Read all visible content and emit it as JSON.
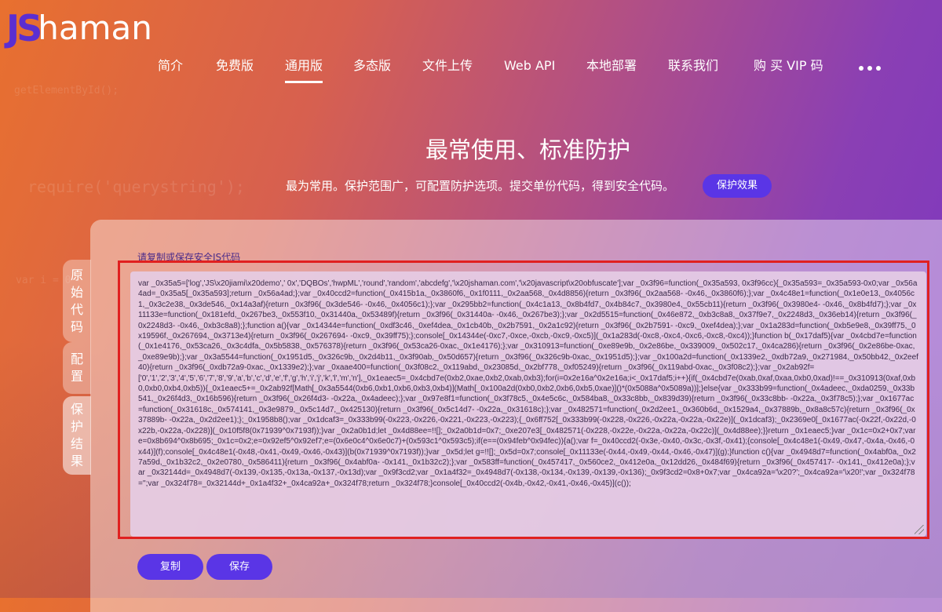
{
  "logo": {
    "js": "JS",
    "rest": "haman"
  },
  "nav": {
    "items": [
      "简介",
      "免费版",
      "通用版",
      "多态版",
      "文件上传",
      "Web API",
      "本地部署",
      "联系我们",
      "购 买 VIP 码"
    ],
    "active_index": 2
  },
  "background_code": [
    "getElementById();",
    "require('querystring');",
    "var i = 0"
  ],
  "hero": {
    "title": "最常使用、标准防护",
    "subtitle": "最为常用。保护范围广，可配置防护选项。提交单份代码，得到安全代码。",
    "button": "保护效果"
  },
  "side_tabs": [
    "原始代码",
    "配置",
    "保护结果"
  ],
  "result": {
    "label": "请复制或保存安全JS代码",
    "code": "var _0x35a5=['log','JS\\x20jiami\\x20demo',' 0x','DQBOs','hwpML','round','random','abcdefg','\\x20jshaman.com','\\x20javascript\\x20obfuscate'];var _0x3f96=function(_0x35a593, 0x3f96cc){_0x35a593=_0x35a593-0x0;var _0x56a4ad=_0x35a5[_0x35a593];return _0x56a4ad;};var _0x40ccd2=function(_0x415b1a,_0x3860f6,_0x1f0111,_0x2aa568,_0x4d8856){return _0x3f96(_0x2aa568- -0x46,_0x3860f6);};var _0x4c48e1=function(_0x1e0e13,_0x4056c1,_0x3c2e38,_0x3de546,_0x14a3af){return _0x3f96(_0x3de546- -0x46,_0x4056c1);};var _0x295bb2=function(_0x4c1a13,_0x8b4fd7,_0x4b84c7,_0x3980e4,_0x55cb11){return _0x3f96(_0x3980e4- -0x46,_0x8b4fd7);};var _0x11133e=function(_0x181efd,_0x267be3,_0x553f10,_0x31440a,_0x53489f){return _0x3f96(_0x31440a- -0x46,_0x267be3);};var _0x2d5515=function(_0x46e872,_0xb3c8a8,_0x37f9e7,_0x2248d3,_0x36eb14){return _0x3f96(_0x2248d3- -0x46,_0xb3c8a8);};function a(){var _0x14344e=function(_0xdf3c46,_0xef4dea,_0x1cb40b,_0x2b7591,_0x2a1c92){return _0x3f96(_0x2b7591- -0xc9,_0xef4dea);};var _0x1a283d=function(_0xb5e9e8,_0x39ff75,_0x19596f,_0x267694,_0x3713e4){return _0x3f96(_0x267694- -0xc9,_0x39ff75);};console[_0x14344e(-0xc7,-0xce,-0xcb,-0xc9,-0xc5)](_0x1a283d(-0xc8,-0xc4,-0xc6,-0xc8,-0xc4));}function b(_0x17daf5){var _0x4cbd7e=function(_0x1e4176,_0x53ca26,_0x3c4dfa,_0x5b5838,_0x576378){return _0x3f96(_0x53ca26-0xac,_0x1e4176);};var _0x310913=function(_0xe89e9b,_0x2e86be,_0x339009,_0x502c17,_0x4ca286){return _0x3f96(_0x2e86be-0xac,_0xe89e9b);};var _0x3a5544=function(_0x1951d5,_0x326c9b,_0x2d4b11,_0x3f90ab,_0x50d657){return _0x3f96(_0x326c9b-0xac,_0x1951d5);};var _0x100a2d=function(_0x1339e2,_0xdb72a9,_0x271984,_0x50bb42,_0x2eef40){return _0x3f96(_0xdb72a9-0xac,_0x1339e2);};var _0xaae400=function(_0x3f08c2,_0x119abd,_0x23085d,_0x2bf778,_0xf05249){return _0x3f96(_0x119abd-0xac,_0x3f08c2);};var _0x2ab92f=['0','1','2','3','4','5','6','7','8','9','a','b','c','d','e','f','g','h','i','j','k','l','m','n'],_0x1eaec5=_0x4cbd7e(0xb2,0xae,0xb2,0xab,0xb3);for(i=0x2e16a^0x2e16a;i<_0x17daf5;i++){if(_0x4cbd7e(0xab,0xaf,0xaa,0xb0,0xad)!==_0x310913(0xaf,0xb0,0xb0,0xb4,0xb5)){_0x1eaec5+=_0x2ab92f[Math[_0x3a5544(0xb6,0xb1,0xb6,0xb3,0xb4)](Math[_0x100a2d(0xb0,0xb2,0xb6,0xb5,0xae)]()*(0x5088a^0x5089a))];}else{var _0x333b99=function(_0x4adeec,_0xda0259,_0x33b541,_0x26f4d3,_0x16b596){return _0x3f96(_0x26f4d3- -0x22a,_0x4adeec);};var _0x97e8f1=function(_0x3f78c5,_0x4e5c6c,_0x584ba8,_0x33c8bb,_0x839d39){return _0x3f96(_0x33c8bb- -0x22a,_0x3f78c5);};var _0x1677ac=function(_0x31618c,_0x574141,_0x3e9879,_0x5c14d7,_0x425130){return _0x3f96(_0x5c14d7- -0x22a,_0x31618c);};var _0x482571=function(_0x2d2ee1,_0x360b6d,_0x1529a4,_0x37889b,_0x8a8c57c){return _0x3f96(_0x37889b- -0x22a,_0x2d2ee1);};_0x1958b8();var _0x1dcaf3=_0x333b99(-0x223,-0x226,-0x221,-0x223,-0x223);{_0x6ff752[_0x333b99(-0x228,-0x226,-0x22a,-0x22a,-0x22e)](_0x1dcaf3);_0x2369e0[_0x1677ac(-0x22f,-0x22d,-0x22b,-0x22a,-0x228)](_0x10f5f8(0x71939^0x7193f));}var _0x2a0b1d;let _0x4d88ee=!![];_0x2a0b1d=0x7;_0xe207e3[_0x482571(-0x228,-0x22e,-0x22a,-0x22a,-0x22c)](_0x4d88ee);}}return _0x1eaec5;}var _0x1c=0x2+0x7;var e=0x8b694^0x8b695;_0x1c=0x2;e=0x92ef5^0x92ef7;e=(0x6e0c4^0x6e0c7)+(0x593c1^0x593c5);if(e==(0x94feb^0x94fec)){a();var f=_0x40ccd2(-0x3e,-0x40,-0x3c,-0x3f,-0x41);{console[_0x4c48e1(-0x49,-0x47,-0x4a,-0x46,-0x44)](f);console[_0x4c48e1(-0x48,-0x41,-0x49,-0x46,-0x43)](b(0x71939^0x7193f));}var _0x5d;let g=!![];_0x5d=0x7;console[_0x11133e(-0x44,-0x49,-0x44,-0x46,-0x47)](g);}function c(){var _0x4948d7=function(_0x4abf0a,_0x27a59d,_0x1b32c2,_0x2e0780,_0x586411){return _0x3f96(_0x4abf0a- -0x141,_0x1b32c2);};var _0x583ff=function(_0x457417,_0x560ce2,_0x412e0a,_0x12dd26,_0x484f69){return _0x3f96(_0x457417- -0x141,_0x412e0a);};var _0x32144d=_0x4948d7(-0x139,-0x135,-0x13a,-0x137,-0x13d);var _0x9f3cd2;var _0x1a4f32=_0x4948d7(-0x138,-0x134,-0x139,-0x139,-0x136);_0x9f3cd2=0x8+0x7;var _0x4ca92a='\\x20?';_0x4ca92a='\\x20!';var _0x324f78='';var _0x324f78=_0x32144d+_0x1a4f32+_0x4ca92a+_0x324f78;return _0x324f78;}console[_0x40ccd2(-0x4b,-0x42,-0x41,-0x46,-0x45)](c());"
  },
  "buttons": {
    "copy": "复制",
    "save": "保存"
  },
  "colors": {
    "accent": "#5a35e6",
    "highlight_border": "#e02020"
  }
}
